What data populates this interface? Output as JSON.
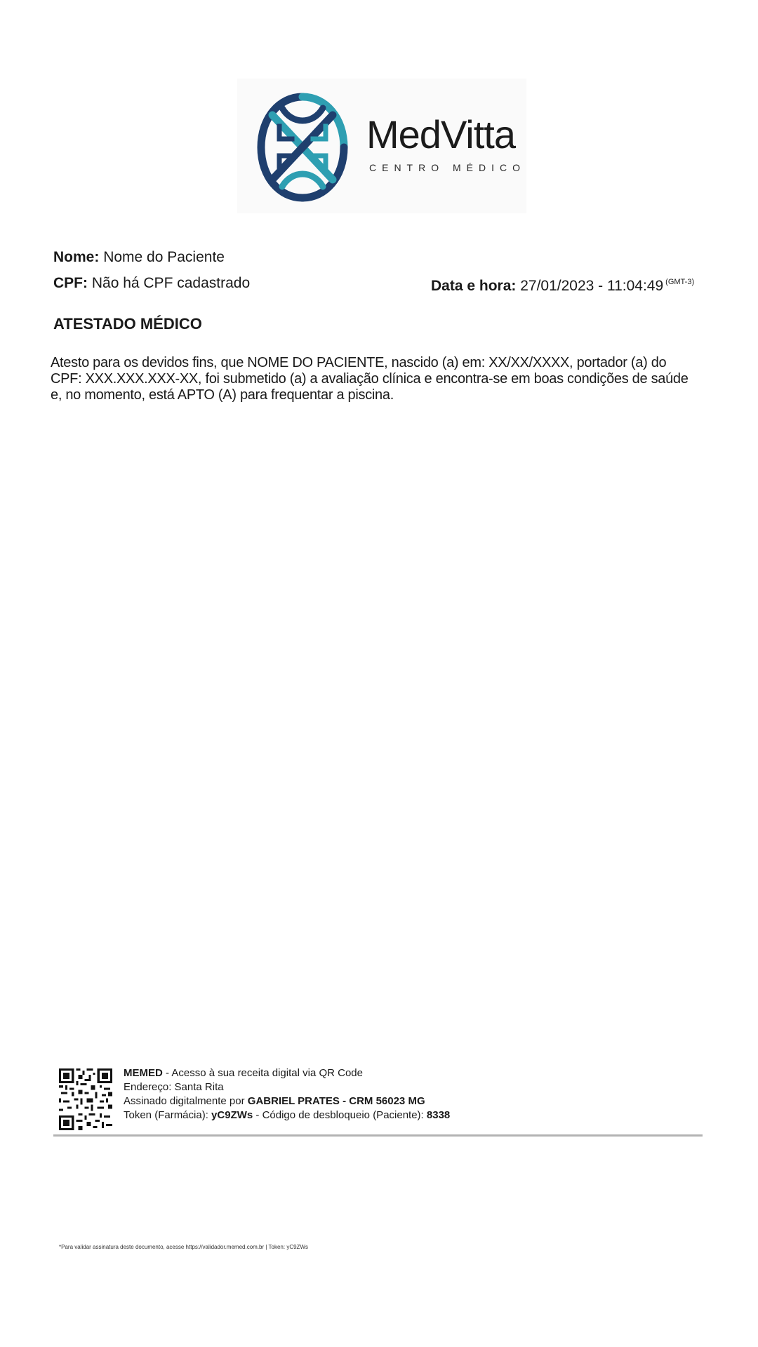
{
  "logo": {
    "name": "MedVitta",
    "subtitle": "CENTRO MÉDICO",
    "icon": "medvitta-cross-logo-icon",
    "colors": {
      "dark": "#1f3f6e",
      "teal": "#2e9fb2"
    }
  },
  "patient": {
    "name_label": "Nome:",
    "name_value": "Nome do Paciente",
    "cpf_label": "CPF:",
    "cpf_value": "Não há CPF cadastrado"
  },
  "date": {
    "label": "Data e hora:",
    "value": "27/01/2023 - 11:04:49",
    "timezone": "(GMT-3)"
  },
  "document": {
    "title": "ATESTADO MÉDICO",
    "body_lines": [
      "Atesto para os devidos fins, que NOME DO PACIENTE, nascido (a) em: XX/XX/XXXX, portador (a) do",
      "CPF: XXX.XXX.XXX-XX, foi submetido (a) a avaliação clínica e encontra-se em boas condições de saúde",
      "e, no momento, está APTO (A) para frequentar a piscina."
    ]
  },
  "footer": {
    "qr_icon": "qr-code-icon",
    "line1_bold": "MEMED",
    "line1_rest": " - Acesso à sua receita digital via QR Code",
    "line2": "Endereço: Santa Rita",
    "line3_pre": "Assinado digitalmente por ",
    "line3_bold": "GABRIEL PRATES - CRM 56023 MG",
    "line4_pre": "Token (Farmácia): ",
    "line4_token": "yC9ZWs",
    "line4_mid": " - Código de desbloqueio (Paciente): ",
    "line4_code": "8338",
    "fine_print": "*Para validar assinatura deste documento, acesse https://validador.memed.com.br | Token: yC9ZWs"
  }
}
